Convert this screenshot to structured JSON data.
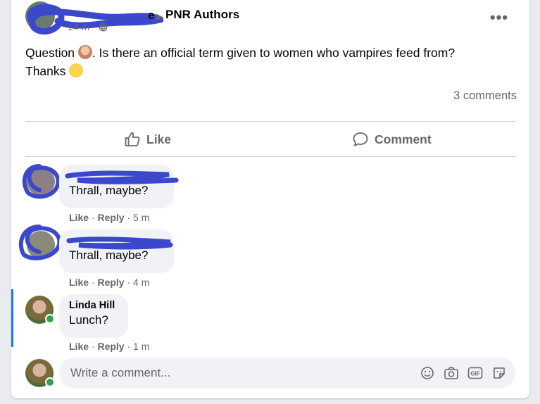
{
  "post": {
    "author_visible_tail": "e",
    "group": "PNR Authors",
    "time": "14 m",
    "dot": "·",
    "more_label": "•••",
    "text_before_emoji": "Question ",
    "text_after_emoji": ". Is there an official term given to women who vampires feed from?",
    "text_line2": "Thanks ",
    "comment_count": "3 comments"
  },
  "actions": {
    "like": "Like",
    "comment": "Comment"
  },
  "comments": [
    {
      "name": "",
      "text": "Thrall, maybe?",
      "like": "Like",
      "reply": "Reply",
      "time": "5 m"
    },
    {
      "name": "",
      "text": "Thrall, maybe?",
      "like": "Like",
      "reply": "Reply",
      "time": "4 m"
    },
    {
      "name": "Linda Hill",
      "text": "Lunch?",
      "like": "Like",
      "reply": "Reply",
      "time": "1 m"
    }
  ],
  "composer": {
    "placeholder": "Write a comment..."
  },
  "colors": {
    "redaction": "#3b48cc",
    "accent": "#1877f2",
    "online": "#31a24c"
  },
  "icons": [
    "globe-icon",
    "more-icon",
    "like-icon",
    "comment-icon",
    "emoji-icon",
    "camera-icon",
    "gif-icon",
    "sticker-icon"
  ]
}
